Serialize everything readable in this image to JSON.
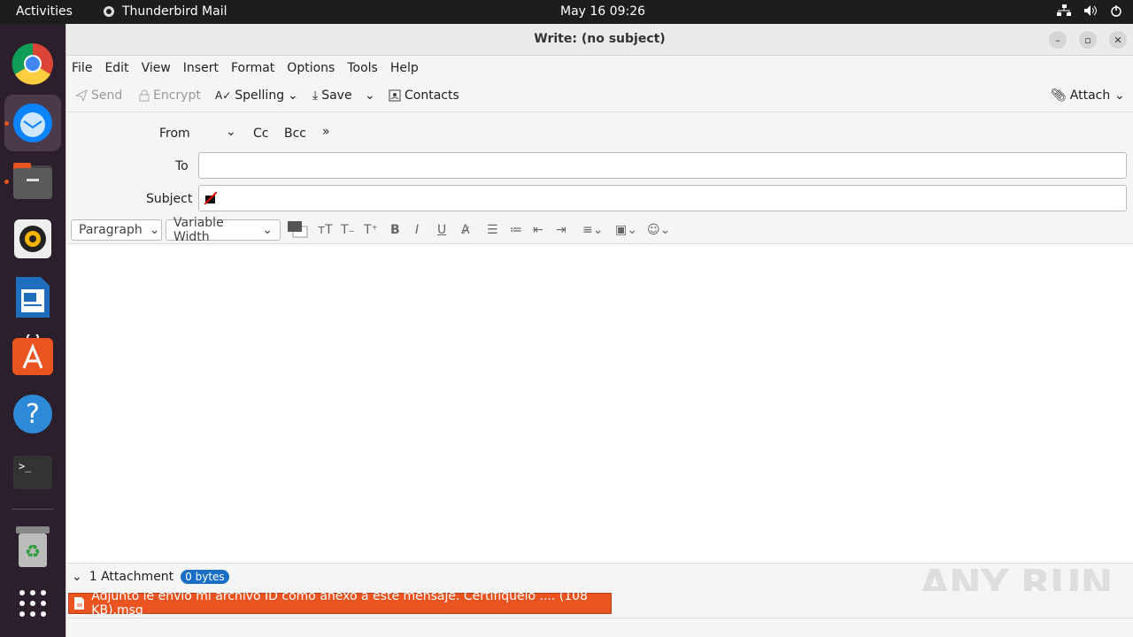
{
  "topbar": {
    "activities": "Activities",
    "app_name": "Thunderbird Mail",
    "clock": "May 16  09:26"
  },
  "window": {
    "title": "Write: (no subject)"
  },
  "menubar": {
    "items": [
      "File",
      "Edit",
      "View",
      "Insert",
      "Format",
      "Options",
      "Tools",
      "Help"
    ]
  },
  "toolbar": {
    "send": "Send",
    "encrypt": "Encrypt",
    "spelling": "Spelling",
    "save": "Save",
    "contacts": "Contacts",
    "attach": "Attach"
  },
  "header": {
    "from": "From",
    "cc": "Cc",
    "bcc": "Bcc",
    "to": "To",
    "subject": "Subject"
  },
  "format": {
    "paragraph": "Paragraph",
    "font": "Variable Width"
  },
  "attachments": {
    "summary": "1 Attachment",
    "size_badge": "0 bytes",
    "file": "Adjunto le envío mi archivo ID como anexo a este mensaje. Certifíquelo .... (108 KB).msg"
  },
  "watermark": "ANY RUN"
}
